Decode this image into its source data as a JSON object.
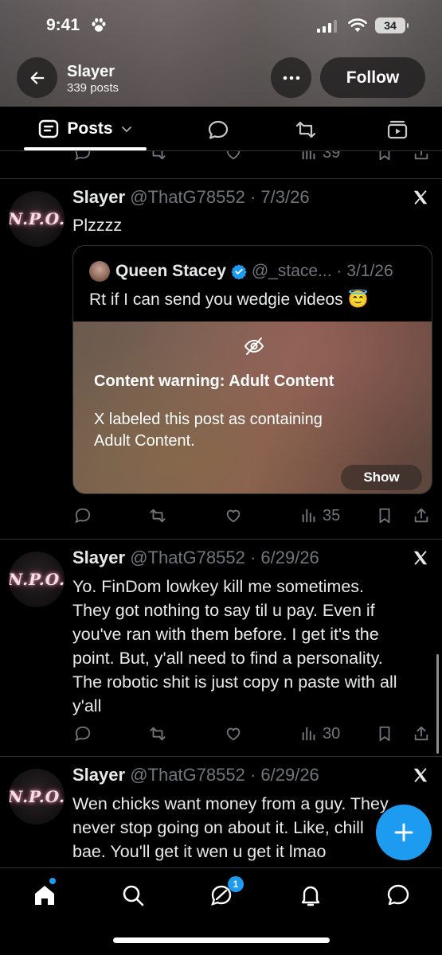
{
  "status_bar": {
    "time": "9:41",
    "battery": "34"
  },
  "header": {
    "name": "Slayer",
    "post_count": "339 posts",
    "follow_label": "Follow"
  },
  "tabs": {
    "posts_label": "Posts"
  },
  "top_actions": {
    "views": "39"
  },
  "posts": [
    {
      "name": "Slayer",
      "meta": "@ThatG78552 · 7/3/26",
      "avatar_text": "N.P.O.",
      "text_lines": [
        "Plzzzz"
      ],
      "quote": {
        "name": "Queen Stacey",
        "meta": "@_stace... · 3/1/26",
        "text": "Rt if I can send you wedgie videos 😇",
        "cw_title": "Content warning: Adult Content",
        "cw_body_lines": [
          "X labeled this post as containing",
          "Adult Content."
        ],
        "show_label": "Show"
      },
      "views": "35"
    },
    {
      "name": "Slayer",
      "meta": "@ThatG78552 · 6/29/26",
      "avatar_text": "N.P.O.",
      "text_lines": [
        "Yo. FinDom lowkey kill me sometimes.",
        "They got nothing to say til u pay. Even if",
        "you've ran with them before. I get it's the",
        "point. But, y'all need to find a personality.",
        "The robotic shit is just copy n paste with all",
        "y'all"
      ],
      "views": "30"
    },
    {
      "name": "Slayer",
      "meta": "@ThatG78552 · 6/29/26",
      "avatar_text": "N.P.O.",
      "text_lines": [
        "Wen chicks want money from a guy. They",
        "never stop going on about it. Like, chill",
        "bae. You'll get it wen u get it lmao"
      ]
    }
  ],
  "bottom_nav": {
    "messages_badge": "1"
  },
  "colors": {
    "accent": "#1d9bf0",
    "muted": "#71767b",
    "divider": "#2f3336"
  },
  "icons": [
    "back-arrow-icon",
    "more-icon",
    "posts-tab-icon",
    "chevron-down-icon",
    "replies-tab-icon",
    "reposts-tab-icon",
    "media-tab-icon",
    "reply-icon",
    "repost-icon",
    "like-icon",
    "views-icon",
    "bookmark-icon",
    "share-icon",
    "x-logo-icon",
    "verified-icon",
    "eye-off-icon",
    "plus-icon",
    "home-icon",
    "search-icon",
    "grok-icon",
    "bell-icon",
    "chat-icon"
  ]
}
